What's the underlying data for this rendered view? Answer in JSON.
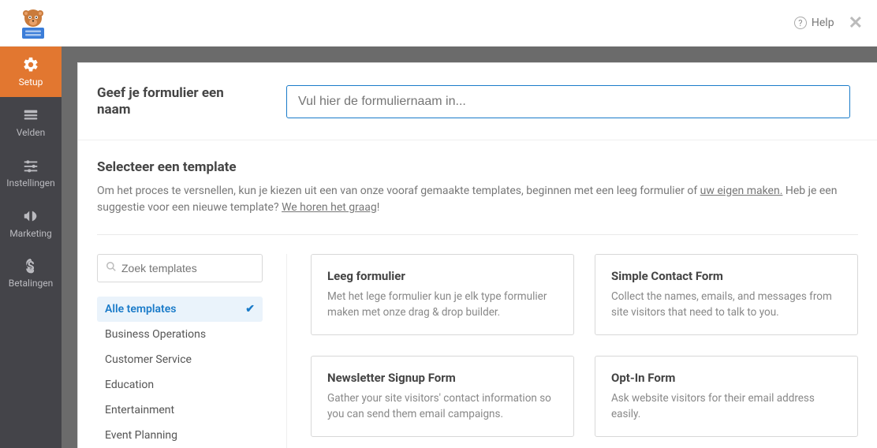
{
  "topbar": {
    "help": "Help"
  },
  "sidebar": {
    "items": [
      {
        "label": "Setup",
        "active": true
      },
      {
        "label": "Velden",
        "active": false
      },
      {
        "label": "Instellingen",
        "active": false
      },
      {
        "label": "Marketing",
        "active": false
      },
      {
        "label": "Betalingen",
        "active": false
      }
    ]
  },
  "header": {
    "title": "Geef je formulier een naam",
    "placeholder": "Vul hier de formuliernaam in..."
  },
  "template_section": {
    "title": "Selecteer een template",
    "desc_pre": "Om het proces te versnellen, kun je kiezen uit een van onze vooraf gemaakte templates, beginnen met een leeg formulier of ",
    "link1": "uw eigen maken.",
    "desc_mid": " Heb je een suggestie voor een nieuwe template? ",
    "link2": "We horen het graag",
    "desc_post": "!"
  },
  "search": {
    "placeholder": "Zoek templates"
  },
  "categories": [
    {
      "label": "Alle templates",
      "active": true
    },
    {
      "label": "Business Operations",
      "active": false
    },
    {
      "label": "Customer Service",
      "active": false
    },
    {
      "label": "Education",
      "active": false
    },
    {
      "label": "Entertainment",
      "active": false
    },
    {
      "label": "Event Planning",
      "active": false
    }
  ],
  "templates": [
    {
      "title": "Leeg formulier",
      "desc": "Met het lege formulier kun je elk type formulier maken met onze drag & drop builder."
    },
    {
      "title": "Simple Contact Form",
      "desc": "Collect the names, emails, and messages from site visitors that need to talk to you."
    },
    {
      "title": "Newsletter Signup Form",
      "desc": "Gather your site visitors' contact information so you can send them email campaigns."
    },
    {
      "title": "Opt-In Form",
      "desc": "Ask website visitors for their email address easily."
    }
  ]
}
